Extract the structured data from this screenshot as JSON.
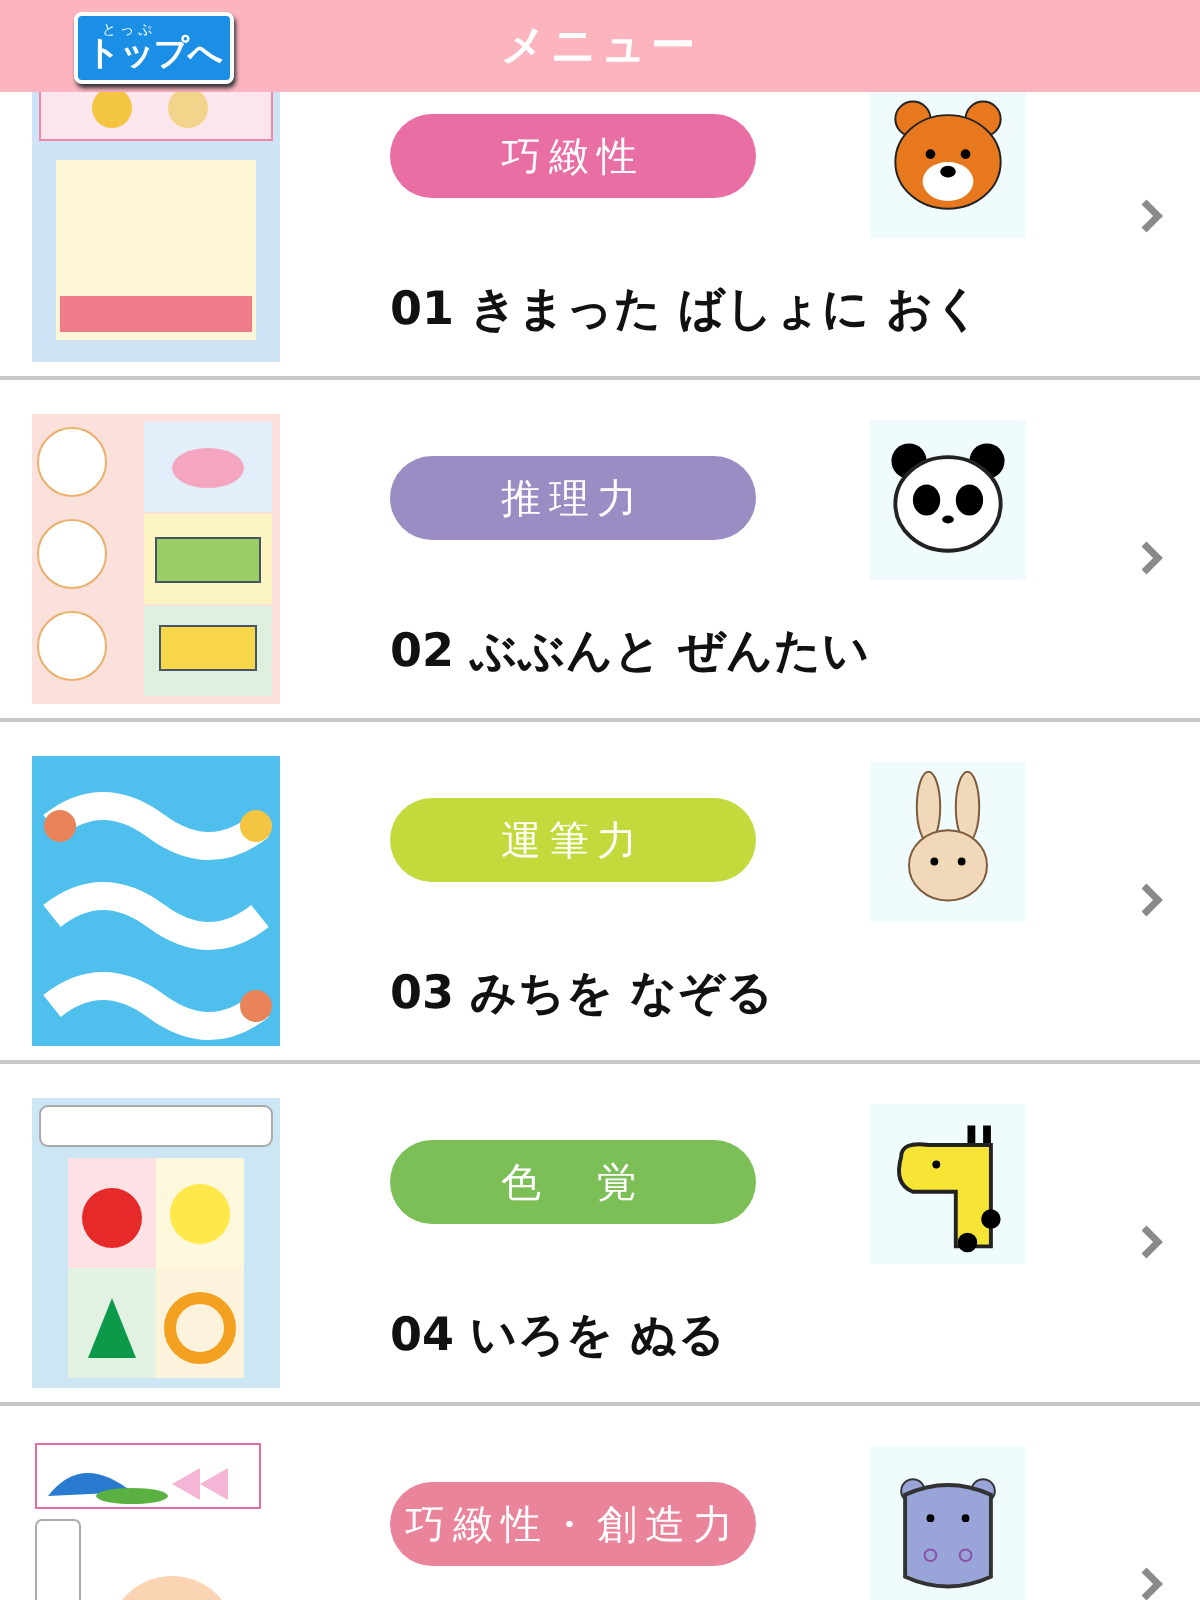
{
  "header": {
    "title": "メニュー",
    "top_button": {
      "reading": "とっぷ",
      "label": "トップへ"
    }
  },
  "menu_items": [
    {
      "tag": "巧緻性",
      "color": "#e86ea4",
      "title": "01 きまった ばしょに おく"
    },
    {
      "tag": "推理力",
      "color": "#9b8cc4",
      "title": "02 ぶぶんと ぜんたい"
    },
    {
      "tag": "運筆力",
      "color": "#c3d93c",
      "title": "03 みちを なぞる"
    },
    {
      "tag": "色　覚",
      "color": "#7cbf57",
      "title": "04 いろを ぬる"
    },
    {
      "tag": "巧緻性・創造力",
      "color": "#e9849a"
    }
  ]
}
